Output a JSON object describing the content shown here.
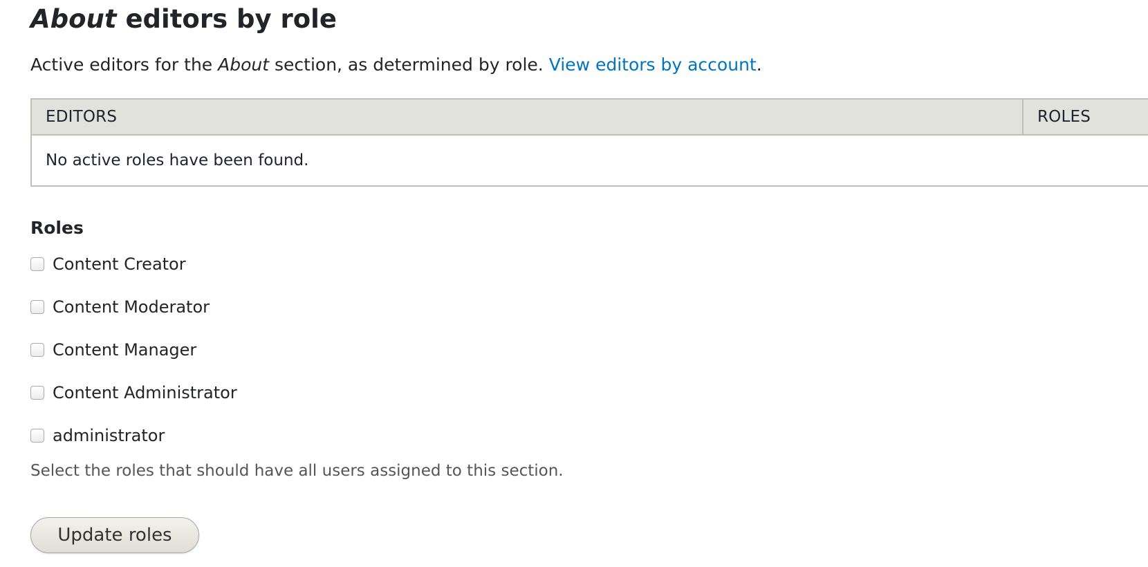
{
  "header": {
    "title_section": "About",
    "title_rest": " editors by role"
  },
  "intro": {
    "prefix": "Active editors for the ",
    "section": "About",
    "suffix": " section, as determined by role. ",
    "link": "View editors by account",
    "end": "."
  },
  "table": {
    "columns": [
      "EDITORS",
      "ROLES"
    ],
    "empty_message": "No active roles have been found."
  },
  "roles": {
    "title": "Roles",
    "items": [
      {
        "label": "Content Creator",
        "checked": false
      },
      {
        "label": "Content Moderator",
        "checked": false
      },
      {
        "label": "Content Manager",
        "checked": false
      },
      {
        "label": "Content Administrator",
        "checked": false
      },
      {
        "label": "administrator",
        "checked": false
      }
    ],
    "help": "Select the roles that should have all users assigned to this section.",
    "button": "Update roles"
  },
  "colors": {
    "link": "#0074bd",
    "table_header_bg": "#e1e2dc",
    "table_border": "#bfbfba"
  }
}
